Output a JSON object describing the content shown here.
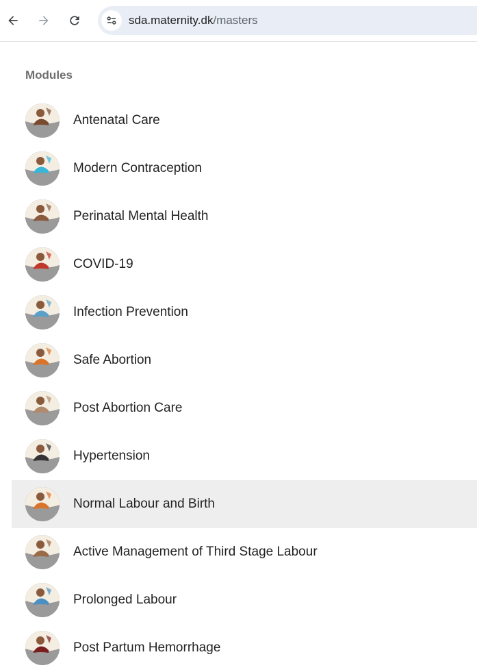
{
  "browser": {
    "back_icon": "back-arrow-icon",
    "forward_icon": "forward-arrow-icon",
    "reload_icon": "reload-icon",
    "site_info_icon": "tune-icon",
    "url_domain": "sda.maternity.dk",
    "url_path": "/masters"
  },
  "page": {
    "heading": "Modules",
    "modules": [
      {
        "label": "Antenatal Care",
        "active": false
      },
      {
        "label": "Modern Contraception",
        "active": false
      },
      {
        "label": "Perinatal Mental Health",
        "active": false
      },
      {
        "label": "COVID-19",
        "active": false
      },
      {
        "label": "Infection Prevention",
        "active": false
      },
      {
        "label": "Safe Abortion",
        "active": false
      },
      {
        "label": "Post Abortion Care",
        "active": false
      },
      {
        "label": "Hypertension",
        "active": false
      },
      {
        "label": "Normal Labour and Birth",
        "active": true
      },
      {
        "label": "Active Management of Third Stage Labour",
        "active": false
      },
      {
        "label": "Prolonged Labour",
        "active": false
      },
      {
        "label": "Post Partum Hemorrhage",
        "active": false
      }
    ]
  },
  "colors": {
    "omnibox_bg": "#e9eef6",
    "active_row_bg": "#eeeeee",
    "heading_text": "#6d6d6d",
    "thumb_base": "#9a9a9a",
    "skin": "#8a5a3c",
    "accent_orange": "#d9742b"
  }
}
